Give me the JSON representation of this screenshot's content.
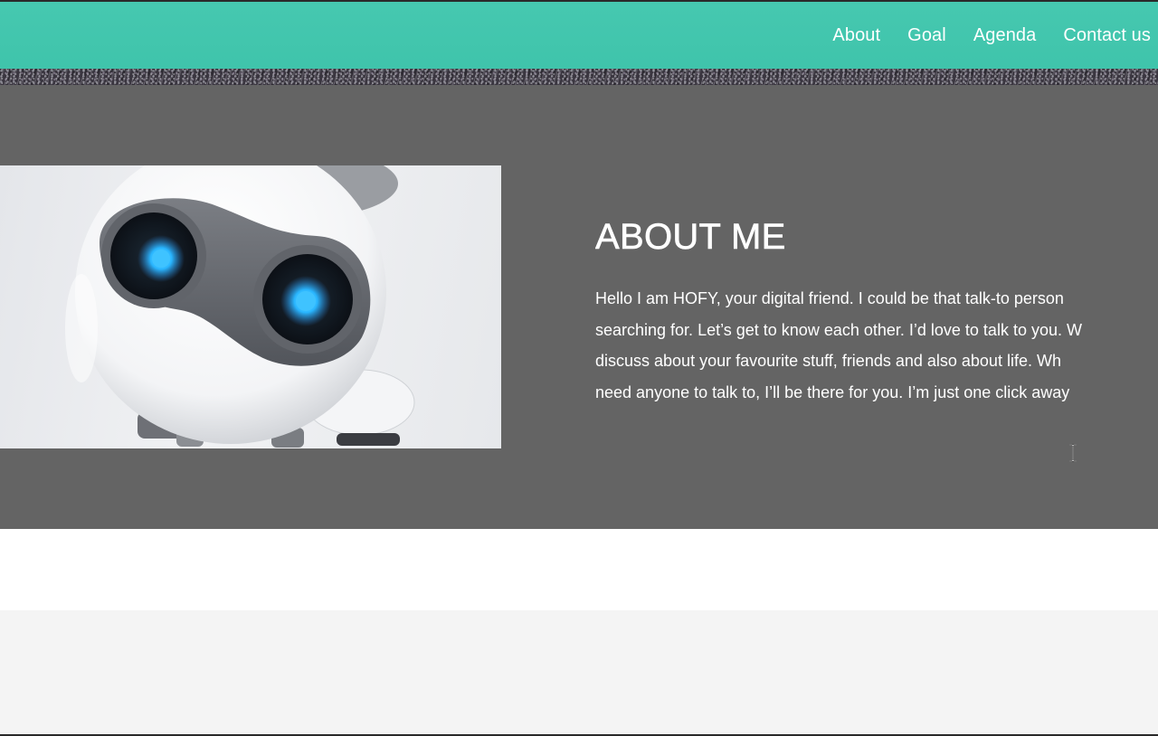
{
  "colors": {
    "navbar_bg": "#46c8b0",
    "section_bg": "#646464",
    "footer_bg": "#f4f4f4",
    "text": "#ffffff",
    "robot_eye_glow": "#29b6ff"
  },
  "nav": {
    "links": [
      {
        "label": "About"
      },
      {
        "label": "Goal"
      },
      {
        "label": "Agenda"
      },
      {
        "label": "Contact us"
      }
    ]
  },
  "about": {
    "image_icon": "robot-illustration",
    "title": "ABOUT ME",
    "lines": [
      "Hello I am HOFY, your digital friend. I could be that talk-to person",
      "searching for. Let’s get to know each other. I’d love to talk to you. W",
      "discuss about your favourite stuff, friends and also about life. Wh",
      "need anyone to talk to, I’ll be there for you. I’m just one click away"
    ]
  },
  "cursor": {
    "icon": "text-cursor-icon"
  }
}
